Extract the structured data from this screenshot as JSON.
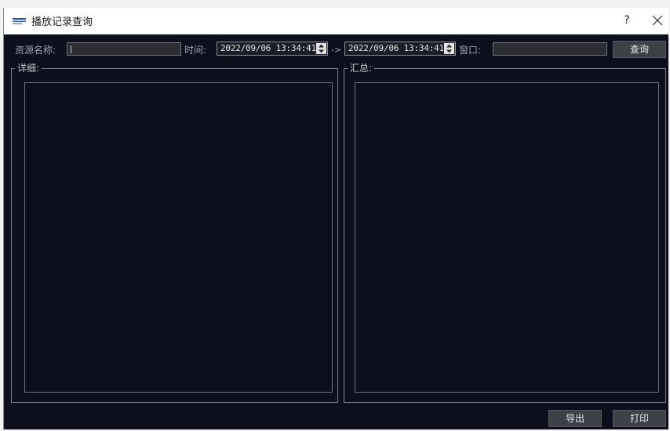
{
  "window": {
    "title": "播放记录查询",
    "help_label": "?"
  },
  "query_bar": {
    "resource_name_label": "资源名称:",
    "resource_name_value": "",
    "time_label": "时间:",
    "start_time": "2022/09/06 13:34:41",
    "arrow": "->",
    "end_time": "2022/09/06 13:34:41",
    "window_label": "窗口:",
    "window_value": "",
    "query_button": "查询"
  },
  "detail_group": {
    "title": "详细:"
  },
  "summary_group": {
    "title": "汇总:"
  },
  "footer": {
    "export_button": "导出",
    "print_button": "打印"
  },
  "colors": {
    "background": "#0d0f1c",
    "titlebar": "#ffffff",
    "button": "#3e4047",
    "input": "#2c2e33"
  },
  "icons": {
    "app_logo": "app-logo-icon",
    "close": "close-icon",
    "spin_up": "spin-up-icon",
    "spin_down": "spin-down-icon"
  }
}
